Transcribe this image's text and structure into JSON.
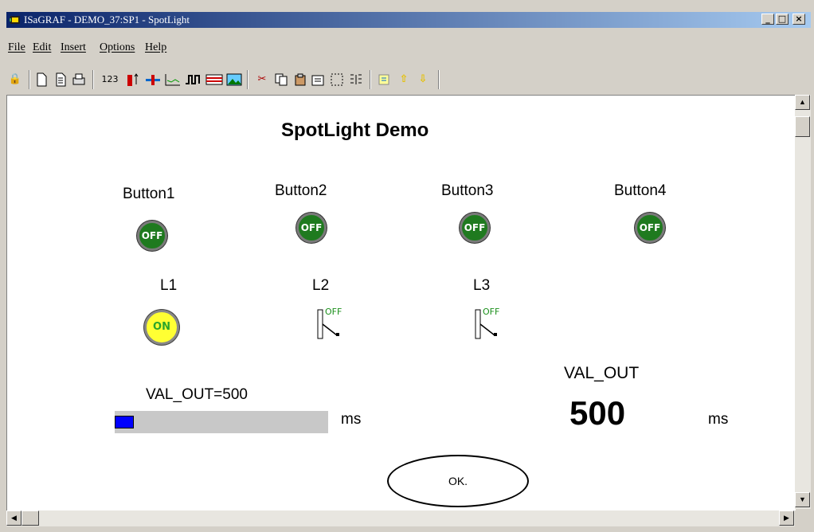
{
  "window": {
    "title": "ISaGRAF - DEMO_37:SP1 - SpotLight"
  },
  "controls": {
    "minimize": "_",
    "maximize": "□",
    "close": "×"
  },
  "menu": [
    "File",
    "Edit",
    "Insert",
    "Options",
    "Help"
  ],
  "toolbar": {
    "numeric_label": "123"
  },
  "content": {
    "heading": "SpotLight Demo",
    "buttons": [
      {
        "label": "Button1",
        "state": "OFF"
      },
      {
        "label": "Button2",
        "state": "OFF"
      },
      {
        "label": "Button3",
        "state": "OFF"
      },
      {
        "label": "Button4",
        "state": "OFF"
      }
    ],
    "lamps": [
      {
        "label": "L1",
        "state": "ON"
      },
      {
        "label": "L2",
        "state": "OFF"
      },
      {
        "label": "L3",
        "state": "OFF"
      }
    ],
    "bar": {
      "caption": "VAL_OUT=500",
      "unit": "ms",
      "fill_fraction": 0.09
    },
    "val_out": {
      "label": "VAL_OUT",
      "value": "500",
      "unit": "ms"
    },
    "ok_button": "OK."
  },
  "colors": {
    "button_green": "#1f7a1f",
    "lamp_on": "#ffff33",
    "bar_fill": "#0000ff",
    "title_active": "#0a246a"
  }
}
